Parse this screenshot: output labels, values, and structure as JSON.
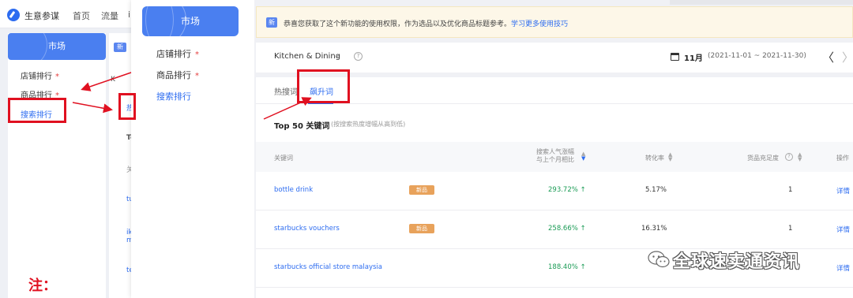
{
  "back_window": {
    "brand": "生意参谋",
    "nav": [
      "首页",
      "流量",
      "i"
    ],
    "market_label": "市场",
    "sidebar_items": [
      {
        "label": "店铺排行",
        "star": "*"
      },
      {
        "label": "商品排行",
        "star": "*"
      },
      {
        "label": "搜索排行",
        "star": ""
      }
    ],
    "note": "注：",
    "col2_badge": "新",
    "col2_fragments": [
      "K",
      "热",
      "To",
      "关",
      "tu",
      "ik",
      "m",
      "te"
    ]
  },
  "middle_window": {
    "market_label": "市场",
    "items": [
      {
        "label": "店铺排行",
        "star": "*"
      },
      {
        "label": "商品排行",
        "star": "*"
      },
      {
        "label": "搜索排行",
        "star": ""
      }
    ]
  },
  "main_window": {
    "notice": {
      "badge": "新",
      "text": "恭喜您获取了这个新功能的使用权限，作为选品以及优化商品标题参考。",
      "link": "学习更多使用技巧"
    },
    "filter": {
      "category": "Kitchen & Dining",
      "caret": "▾",
      "help": "?",
      "month": "11月",
      "range": "(2021-11-01 ~ 2021-11-30)",
      "prev": "〈",
      "next": "〉"
    },
    "tabs": [
      "热搜词",
      "飙升词"
    ],
    "active_tab": "飙升词",
    "section_title": "Top 50 关键词",
    "section_subtitle": "(按搜索热度增幅从高到低)",
    "table": {
      "headers": {
        "keyword": "关键词",
        "growth_line1": "搜索人气涨幅",
        "growth_line2": "与上个月相比",
        "conversion": "转化率",
        "supply": "货品充足度",
        "action": "操作"
      },
      "rows": [
        {
          "keyword": "bottle drink",
          "tag": "新品",
          "growth": "293.72% ↑",
          "conversion": "5.17%",
          "supply": "1",
          "action": "详情"
        },
        {
          "keyword": "starbucks vouchers",
          "tag": "新品",
          "growth": "258.66% ↑",
          "conversion": "16.31%",
          "supply": "1",
          "action": "详情"
        },
        {
          "keyword": "starbucks official store malaysia",
          "tag": "",
          "growth": "188.40% ↑",
          "conversion": "",
          "supply": "1",
          "action": "详情"
        }
      ]
    }
  },
  "watermark": "全球速卖通资讯",
  "colors": {
    "accent": "#2d6cf0",
    "annotation": "#e01020",
    "growth": "#1a9b55",
    "tag": "#e8a25b"
  }
}
